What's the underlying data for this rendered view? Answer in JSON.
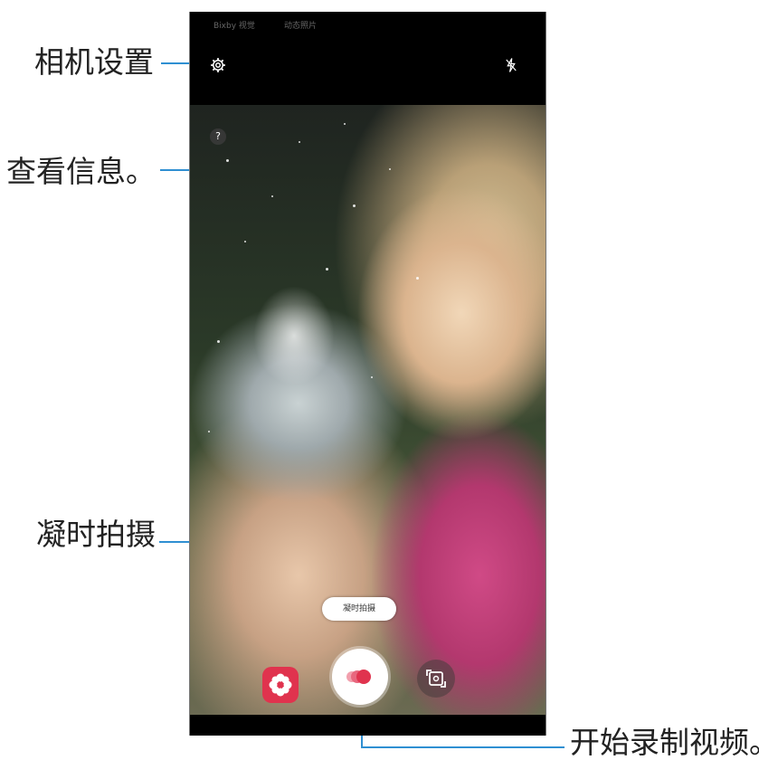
{
  "callouts": {
    "camera_settings": "相机设置",
    "view_info": "查看信息。",
    "hyperlapse": "凝时拍摄",
    "start_recording": "开始录制视频。"
  },
  "status_bar": {
    "left_text": "Bixby 视觉",
    "right_text": "动态照片"
  },
  "viewfinder": {
    "info_icon_label": "?",
    "mode_pill_label": "凝时拍摄"
  },
  "icons": {
    "settings": "gear-icon",
    "flash": "flash-off-icon",
    "info": "question-icon",
    "effects": "flower-icon",
    "record": "hyperlapse-record-icon",
    "switch_camera": "switch-camera-icon"
  },
  "colors": {
    "callout_line": "#2f8fd2",
    "effect_button": "#e0334e",
    "record_dots": "#e0334e"
  }
}
